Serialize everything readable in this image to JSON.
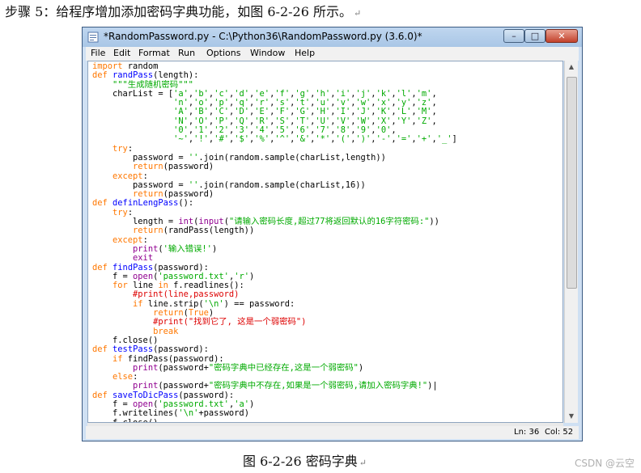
{
  "document": {
    "step_text": "步骤 5：给程序增加添加密码字典功能，如图 6-2-26 所示。",
    "paragraph_mark": "↵",
    "caption": "图 6-2-26 密码字典",
    "watermark": "CSDN @云空"
  },
  "window": {
    "title": "*RandomPassword.py - C:\\Python36\\RandomPassword.py (3.6.0)*",
    "buttons": {
      "minimize": "–",
      "maximize": "□",
      "close": "✕"
    },
    "menu": [
      "File",
      "Edit",
      "Format",
      "Run",
      "Options",
      "Window",
      "Help"
    ],
    "status": {
      "line": "Ln: 36",
      "col": "Col: 52"
    }
  },
  "colors": {
    "keyword": "#ff7700",
    "function_name": "#0000ff",
    "string": "#00aa00",
    "comment": "#dd0000",
    "builtin": "#900090"
  },
  "code_lines": [
    [
      [
        "kw",
        "import"
      ],
      [
        "t",
        " random"
      ]
    ],
    [
      [
        "kw",
        "def"
      ],
      [
        "t",
        " "
      ],
      [
        "fn",
        "randPass"
      ],
      [
        "t",
        "(length):"
      ]
    ],
    [
      [
        "t",
        "    "
      ],
      [
        "str",
        "\"\"\"生成随机密码\"\"\""
      ]
    ],
    [
      [
        "t",
        "    charList = ["
      ],
      [
        "str",
        "'a'"
      ],
      [
        "t",
        ","
      ],
      [
        "str",
        "'b'"
      ],
      [
        "t",
        ","
      ],
      [
        "str",
        "'c'"
      ],
      [
        "t",
        ","
      ],
      [
        "str",
        "'d'"
      ],
      [
        "t",
        ","
      ],
      [
        "str",
        "'e'"
      ],
      [
        "t",
        ","
      ],
      [
        "str",
        "'f'"
      ],
      [
        "t",
        ","
      ],
      [
        "str",
        "'g'"
      ],
      [
        "t",
        ","
      ],
      [
        "str",
        "'h'"
      ],
      [
        "t",
        ","
      ],
      [
        "str",
        "'i'"
      ],
      [
        "t",
        ","
      ],
      [
        "str",
        "'j'"
      ],
      [
        "t",
        ","
      ],
      [
        "str",
        "'k'"
      ],
      [
        "t",
        ","
      ],
      [
        "str",
        "'l'"
      ],
      [
        "t",
        ","
      ],
      [
        "str",
        "'m'"
      ],
      [
        "t",
        ","
      ]
    ],
    [
      [
        "t",
        "                "
      ],
      [
        "str",
        "'n'"
      ],
      [
        "t",
        ","
      ],
      [
        "str",
        "'o'"
      ],
      [
        "t",
        ","
      ],
      [
        "str",
        "'p'"
      ],
      [
        "t",
        ","
      ],
      [
        "str",
        "'q'"
      ],
      [
        "t",
        ","
      ],
      [
        "str",
        "'r'"
      ],
      [
        "t",
        ","
      ],
      [
        "str",
        "'s'"
      ],
      [
        "t",
        ","
      ],
      [
        "str",
        "'t'"
      ],
      [
        "t",
        ","
      ],
      [
        "str",
        "'u'"
      ],
      [
        "t",
        ","
      ],
      [
        "str",
        "'v'"
      ],
      [
        "t",
        ","
      ],
      [
        "str",
        "'w'"
      ],
      [
        "t",
        ","
      ],
      [
        "str",
        "'x'"
      ],
      [
        "t",
        ","
      ],
      [
        "str",
        "'y'"
      ],
      [
        "t",
        ","
      ],
      [
        "str",
        "'z'"
      ],
      [
        "t",
        ","
      ]
    ],
    [
      [
        "t",
        "                "
      ],
      [
        "str",
        "'A'"
      ],
      [
        "t",
        ","
      ],
      [
        "str",
        "'B'"
      ],
      [
        "t",
        ","
      ],
      [
        "str",
        "'C'"
      ],
      [
        "t",
        ","
      ],
      [
        "str",
        "'D'"
      ],
      [
        "t",
        ","
      ],
      [
        "str",
        "'E'"
      ],
      [
        "t",
        ","
      ],
      [
        "str",
        "'F'"
      ],
      [
        "t",
        ","
      ],
      [
        "str",
        "'G'"
      ],
      [
        "t",
        ","
      ],
      [
        "str",
        "'H'"
      ],
      [
        "t",
        ","
      ],
      [
        "str",
        "'I'"
      ],
      [
        "t",
        ","
      ],
      [
        "str",
        "'J'"
      ],
      [
        "t",
        ","
      ],
      [
        "str",
        "'K'"
      ],
      [
        "t",
        ","
      ],
      [
        "str",
        "'L'"
      ],
      [
        "t",
        ","
      ],
      [
        "str",
        "'M'"
      ],
      [
        "t",
        ","
      ]
    ],
    [
      [
        "t",
        "                "
      ],
      [
        "str",
        "'N'"
      ],
      [
        "t",
        ","
      ],
      [
        "str",
        "'O'"
      ],
      [
        "t",
        ","
      ],
      [
        "str",
        "'P'"
      ],
      [
        "t",
        ","
      ],
      [
        "str",
        "'Q'"
      ],
      [
        "t",
        ","
      ],
      [
        "str",
        "'R'"
      ],
      [
        "t",
        ","
      ],
      [
        "str",
        "'S'"
      ],
      [
        "t",
        ","
      ],
      [
        "str",
        "'T'"
      ],
      [
        "t",
        ","
      ],
      [
        "str",
        "'U'"
      ],
      [
        "t",
        ","
      ],
      [
        "str",
        "'V'"
      ],
      [
        "t",
        ","
      ],
      [
        "str",
        "'W'"
      ],
      [
        "t",
        ","
      ],
      [
        "str",
        "'X'"
      ],
      [
        "t",
        ","
      ],
      [
        "str",
        "'Y'"
      ],
      [
        "t",
        ","
      ],
      [
        "str",
        "'Z'"
      ],
      [
        "t",
        ","
      ]
    ],
    [
      [
        "t",
        "                "
      ],
      [
        "str",
        "'0'"
      ],
      [
        "t",
        ","
      ],
      [
        "str",
        "'1'"
      ],
      [
        "t",
        ","
      ],
      [
        "str",
        "'2'"
      ],
      [
        "t",
        ","
      ],
      [
        "str",
        "'3'"
      ],
      [
        "t",
        ","
      ],
      [
        "str",
        "'4'"
      ],
      [
        "t",
        ","
      ],
      [
        "str",
        "'5'"
      ],
      [
        "t",
        ","
      ],
      [
        "str",
        "'6'"
      ],
      [
        "t",
        ","
      ],
      [
        "str",
        "'7'"
      ],
      [
        "t",
        ","
      ],
      [
        "str",
        "'8'"
      ],
      [
        "t",
        ","
      ],
      [
        "str",
        "'9'"
      ],
      [
        "t",
        ","
      ],
      [
        "str",
        "'0'"
      ],
      [
        "t",
        ","
      ]
    ],
    [
      [
        "t",
        "                "
      ],
      [
        "str",
        "'~'"
      ],
      [
        "t",
        ","
      ],
      [
        "str",
        "'!'"
      ],
      [
        "t",
        ","
      ],
      [
        "str",
        "'#'"
      ],
      [
        "t",
        ","
      ],
      [
        "str",
        "'$'"
      ],
      [
        "t",
        ","
      ],
      [
        "str",
        "'%'"
      ],
      [
        "t",
        ","
      ],
      [
        "str",
        "'^'"
      ],
      [
        "t",
        ","
      ],
      [
        "str",
        "'&'"
      ],
      [
        "t",
        ","
      ],
      [
        "str",
        "'*'"
      ],
      [
        "t",
        ","
      ],
      [
        "str",
        "'('"
      ],
      [
        "t",
        ","
      ],
      [
        "str",
        "')'"
      ],
      [
        "t",
        ","
      ],
      [
        "str",
        "'-'"
      ],
      [
        "t",
        ","
      ],
      [
        "str",
        "'='"
      ],
      [
        "t",
        ","
      ],
      [
        "str",
        "'+'"
      ],
      [
        "t",
        ","
      ],
      [
        "str",
        "'_'"
      ],
      [
        "t",
        "]"
      ]
    ],
    [
      [
        "t",
        "    "
      ],
      [
        "kw",
        "try"
      ],
      [
        "t",
        ":"
      ]
    ],
    [
      [
        "t",
        "        password = "
      ],
      [
        "str",
        "''"
      ],
      [
        "t",
        ".join(random.sample(charList,length))"
      ]
    ],
    [
      [
        "t",
        "        "
      ],
      [
        "kw",
        "return"
      ],
      [
        "t",
        "(password)"
      ]
    ],
    [
      [
        "t",
        "    "
      ],
      [
        "kw",
        "except"
      ],
      [
        "t",
        ":"
      ]
    ],
    [
      [
        "t",
        "        password = "
      ],
      [
        "str",
        "''"
      ],
      [
        "t",
        ".join(random.sample(charList,16))"
      ]
    ],
    [
      [
        "t",
        "        "
      ],
      [
        "kw",
        "return"
      ],
      [
        "t",
        "(password)"
      ]
    ],
    [
      [
        "kw",
        "def"
      ],
      [
        "t",
        " "
      ],
      [
        "fn",
        "definLengPass"
      ],
      [
        "t",
        "():"
      ]
    ],
    [
      [
        "t",
        "    "
      ],
      [
        "kw",
        "try"
      ],
      [
        "t",
        ":"
      ]
    ],
    [
      [
        "t",
        "        length = "
      ],
      [
        "bi",
        "int"
      ],
      [
        "t",
        "("
      ],
      [
        "bi",
        "input"
      ],
      [
        "t",
        "("
      ],
      [
        "str",
        "\"请输入密码长度,超过77将返回默认的16字符密码:\""
      ],
      [
        "t",
        "))"
      ]
    ],
    [
      [
        "t",
        "        "
      ],
      [
        "kw",
        "return"
      ],
      [
        "t",
        "(randPass(length))"
      ]
    ],
    [
      [
        "t",
        "    "
      ],
      [
        "kw",
        "except"
      ],
      [
        "t",
        ":"
      ]
    ],
    [
      [
        "t",
        "        "
      ],
      [
        "bi",
        "print"
      ],
      [
        "t",
        "("
      ],
      [
        "str",
        "'输入错误!'"
      ],
      [
        "t",
        ")"
      ]
    ],
    [
      [
        "t",
        "        "
      ],
      [
        "bi",
        "exit"
      ]
    ],
    [
      [
        "kw",
        "def"
      ],
      [
        "t",
        " "
      ],
      [
        "fn",
        "findPass"
      ],
      [
        "t",
        "(password):"
      ]
    ],
    [
      [
        "t",
        "    f = "
      ],
      [
        "bi",
        "open"
      ],
      [
        "t",
        "("
      ],
      [
        "str",
        "'password.txt'"
      ],
      [
        "t",
        ","
      ],
      [
        "str",
        "'r'"
      ],
      [
        "t",
        ")"
      ]
    ],
    [
      [
        "t",
        "    "
      ],
      [
        "kw",
        "for"
      ],
      [
        "t",
        " line "
      ],
      [
        "kw",
        "in"
      ],
      [
        "t",
        " f.readlines():"
      ]
    ],
    [
      [
        "t",
        "        "
      ],
      [
        "cm",
        "#print(line,password)"
      ]
    ],
    [
      [
        "t",
        "        "
      ],
      [
        "kw",
        "if"
      ],
      [
        "t",
        " line.strip("
      ],
      [
        "str",
        "'\\n'"
      ],
      [
        "t",
        ") == password:"
      ]
    ],
    [
      [
        "t",
        "            "
      ],
      [
        "kw",
        "return"
      ],
      [
        "t",
        "("
      ],
      [
        "kw",
        "True"
      ],
      [
        "t",
        ")"
      ]
    ],
    [
      [
        "t",
        "            "
      ],
      [
        "cm",
        "#print(\"找到它了, 这是一个弱密码\")"
      ]
    ],
    [
      [
        "t",
        "            "
      ],
      [
        "kw",
        "break"
      ]
    ],
    [
      [
        "t",
        "    f.close()"
      ]
    ],
    [
      [
        "kw",
        "def"
      ],
      [
        "t",
        " "
      ],
      [
        "fn",
        "testPass"
      ],
      [
        "t",
        "(password):"
      ]
    ],
    [
      [
        "t",
        "    "
      ],
      [
        "kw",
        "if"
      ],
      [
        "t",
        " findPass(password):"
      ]
    ],
    [
      [
        "t",
        "        "
      ],
      [
        "bi",
        "print"
      ],
      [
        "t",
        "(password+"
      ],
      [
        "str",
        "\"密码字典中已经存在,这是一个弱密码\""
      ],
      [
        "t",
        ")"
      ]
    ],
    [
      [
        "t",
        "    "
      ],
      [
        "kw",
        "else"
      ],
      [
        "t",
        ":"
      ]
    ],
    [
      [
        "t",
        "        "
      ],
      [
        "bi",
        "print"
      ],
      [
        "t",
        "(password+"
      ],
      [
        "str",
        "\"密码字典中不存在,如果是一个弱密码,请加入密码字典!\""
      ],
      [
        "t",
        ")|"
      ]
    ],
    [
      [
        "kw",
        "def"
      ],
      [
        "t",
        " "
      ],
      [
        "fn",
        "saveToDicPass"
      ],
      [
        "t",
        "(password):"
      ]
    ],
    [
      [
        "t",
        "    f = "
      ],
      [
        "bi",
        "open"
      ],
      [
        "t",
        "("
      ],
      [
        "str",
        "'password.txt'"
      ],
      [
        "t",
        ","
      ],
      [
        "str",
        "'a'"
      ],
      [
        "t",
        ")"
      ]
    ],
    [
      [
        "t",
        "    f.writelines("
      ],
      [
        "str",
        "'\\n'"
      ],
      [
        "t",
        "+password)"
      ]
    ],
    [
      [
        "t",
        "    f.close()"
      ]
    ]
  ]
}
